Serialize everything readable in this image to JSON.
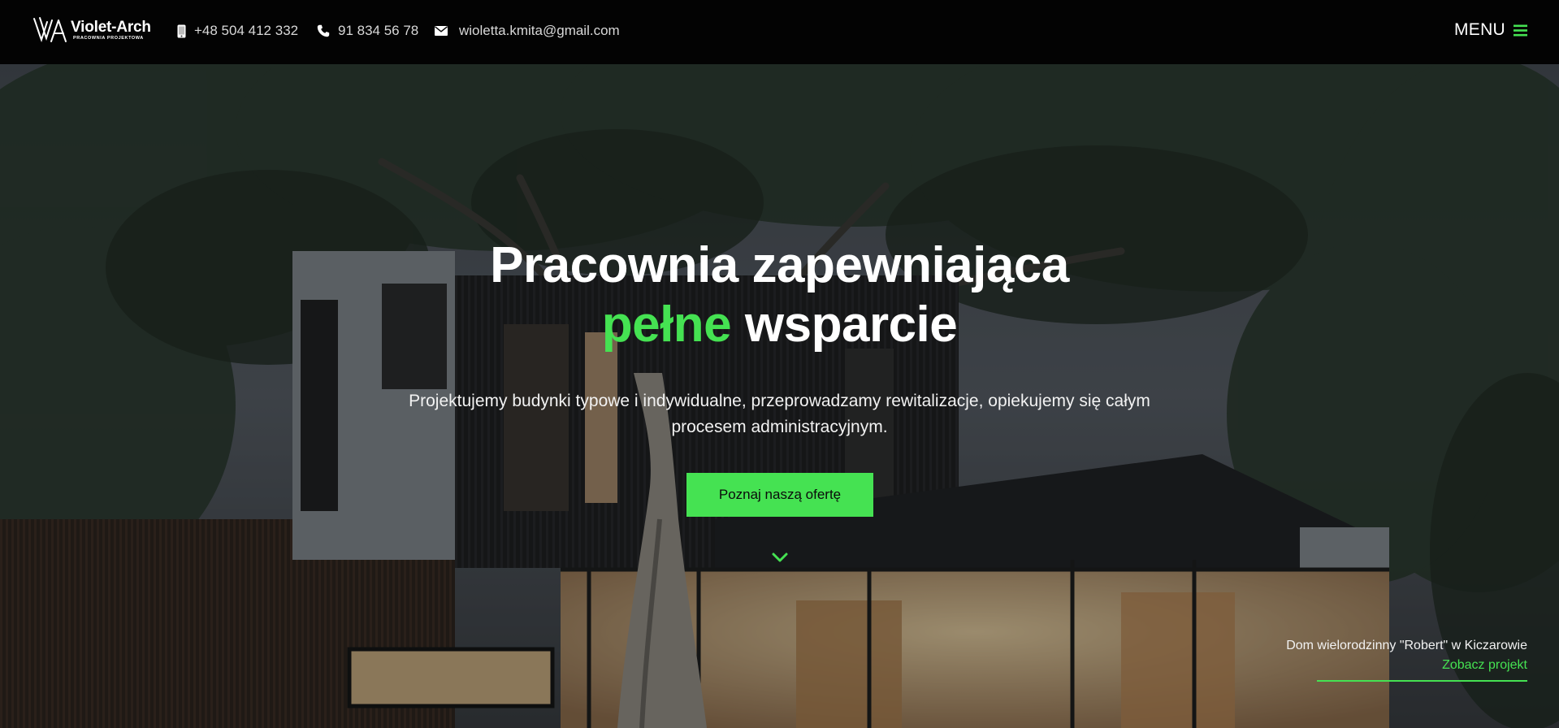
{
  "header": {
    "logo": {
      "monogram": "VA",
      "name": "Violet-Arch",
      "subtitle": "PRACOWNIA PROJEKTOWA"
    },
    "contacts": [
      {
        "icon": "mobile-phone-icon",
        "text": "+48 504 412 332"
      },
      {
        "icon": "phone-icon",
        "text": "91 834 56 78"
      },
      {
        "icon": "envelope-icon",
        "text": "wioletta.kmita@gmail.com"
      }
    ],
    "menu": {
      "label": "MENU",
      "icon": "hamburger-icon"
    }
  },
  "hero": {
    "headline_line1": "Pracownia zapewniająca",
    "headline_accent": "pełne",
    "headline_rest": "wsparcie",
    "lead": "Projektujemy budynki typowe i indywidualne, przeprowadzamy rewitalizacje, opiekujemy się całym procesem administracyjnym.",
    "cta_label": "Poznaj naszą ofertę",
    "scroll_icon": "chevron-down-icon",
    "project": {
      "title": "Dom wielorodzinny \"Robert\" w Kiczarowie",
      "link_label": "Zobacz projekt"
    }
  },
  "colors": {
    "accent": "#45e252",
    "header_bg": "#030303",
    "text": "#ffffff"
  }
}
